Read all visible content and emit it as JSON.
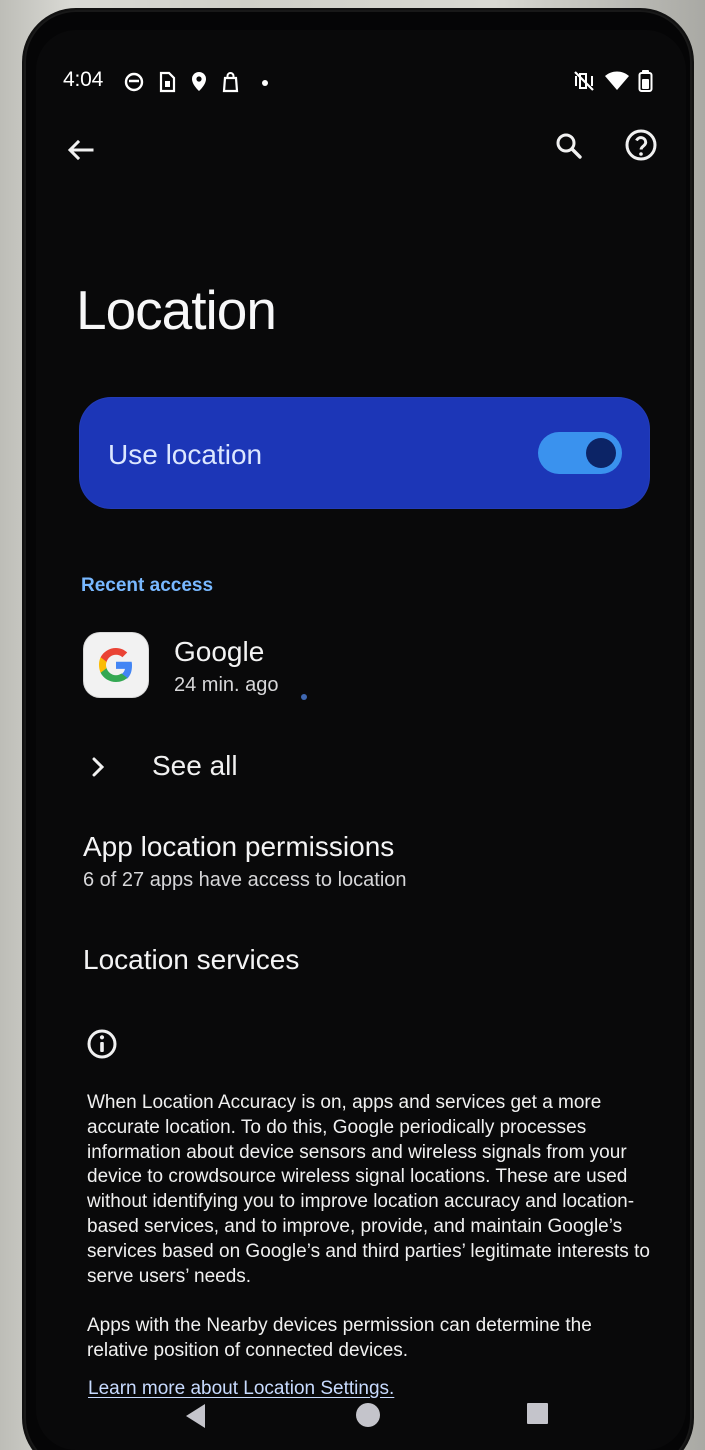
{
  "status_bar": {
    "time": "4:04",
    "left_icons": [
      "circle-notification-icon",
      "sim-card-icon",
      "location-pin-icon",
      "shopping-bag-icon",
      "notification-dot-icon"
    ],
    "right_icons": [
      "vibrate-off-icon",
      "wifi-icon",
      "battery-icon"
    ]
  },
  "top_bar": {
    "back_icon": "arrow-back-icon",
    "search_icon": "search-icon",
    "help_icon": "help-icon"
  },
  "page": {
    "title": "Location"
  },
  "use_location": {
    "label": "Use location",
    "enabled": true,
    "colors": {
      "card": "#1c36b7",
      "switch_track": "#3a92ee",
      "switch_thumb": "#0c2466"
    }
  },
  "recent_access": {
    "label": "Recent access",
    "items": [
      {
        "name": "Google",
        "time": "24 min. ago",
        "icon": "google-g-icon"
      }
    ],
    "see_all": "See all"
  },
  "settings": {
    "app_location_permissions": {
      "title": "App location permissions",
      "subtitle": "6 of 27 apps have access to location"
    },
    "location_services": {
      "title": "Location services"
    }
  },
  "info": {
    "icon": "info-icon",
    "paragraphs": [
      "When Location Accuracy is on, apps and services get a more accurate location. To do this, Google periodically processes information about device sensors and wireless signals from your device to crowdsource wireless signal locations. These are used without identifying you to improve location accuracy and location-based services, and to improve, provide, and maintain Google’s services based on Google’s and third parties’ legitimate interests to serve users’ needs.",
      "Apps with the Nearby devices permission can determine the relative position of connected devices."
    ],
    "learn_more": "Learn more about Location Settings."
  },
  "navigation": {
    "back_icon": "triangle-back-icon",
    "home_icon": "circle-home-icon",
    "recent_icon": "square-recents-icon"
  }
}
